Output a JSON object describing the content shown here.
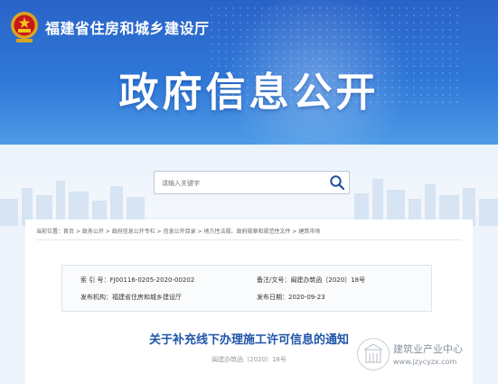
{
  "header": {
    "site_name": "福建省住房和城乡建设厅",
    "hero_title": "政府信息公开"
  },
  "search": {
    "placeholder": "请输入关键字"
  },
  "breadcrumb": {
    "prefix": "当前位置：",
    "items": [
      "首页",
      "政务公开",
      "政府信息公开专栏",
      "信息公开目录",
      "地方性法规、政府规章和规范性文件",
      "建筑市场"
    ],
    "separator": " > "
  },
  "meta": {
    "index_label": "索 引 号：",
    "index_value": "FJ00116-0205-2020-00202",
    "ref_label": "备注/文号：",
    "ref_value": "闽建办筑函〔2020〕18号",
    "issuer_label": "发布机构：",
    "issuer_value": "福建省住房和城乡建设厅",
    "date_label": "发布日期：",
    "date_value": "2020-09-23"
  },
  "document": {
    "title": "关于补充线下办理施工许可信息的通知",
    "number": "闽建办筑函〔2020〕18号"
  },
  "watermark": {
    "cn": "建筑业产业中心",
    "en": "www.jzycyzx.com"
  },
  "colors": {
    "banner": "#2f78d8",
    "title_blue": "#1f55a9"
  }
}
